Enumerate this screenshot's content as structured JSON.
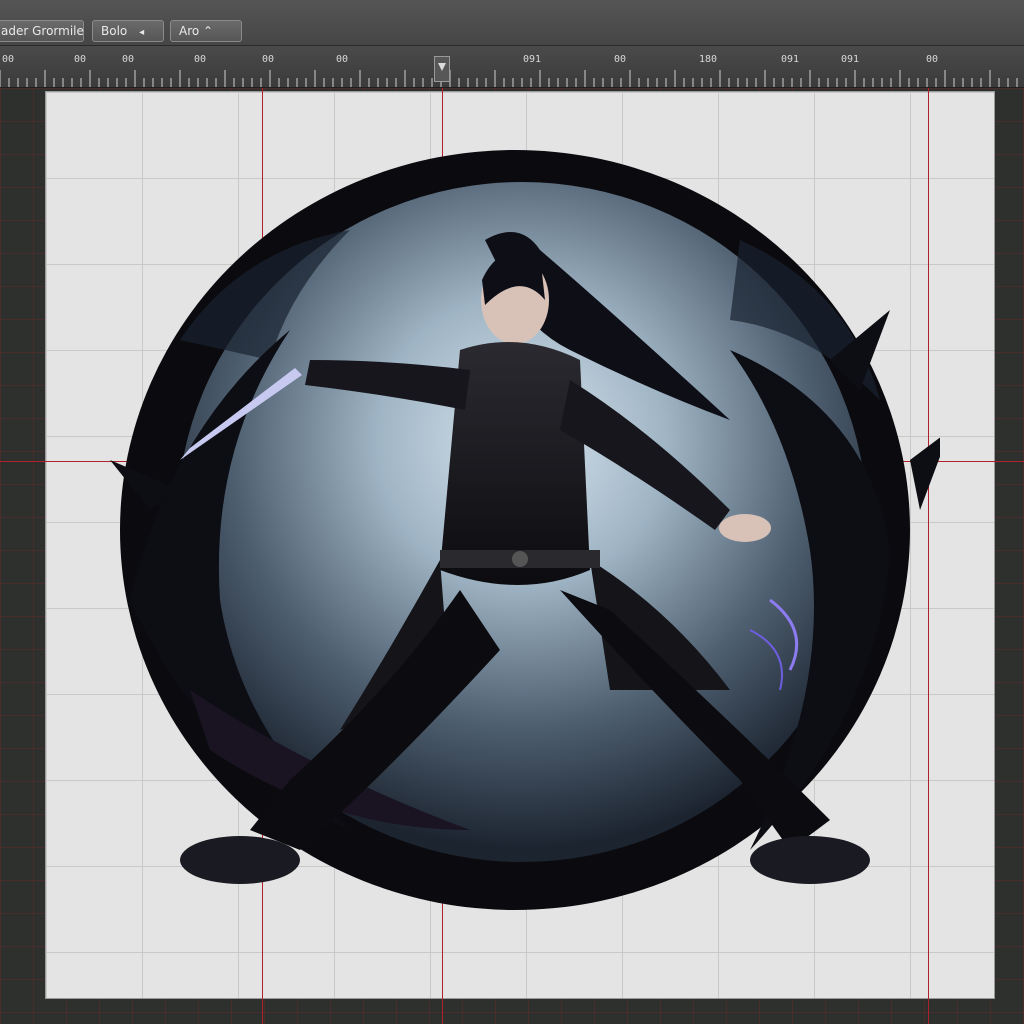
{
  "toolbar": {
    "title_partial": "ader Grormile",
    "button_1_label": "Bolo",
    "button_1_caret": "◂",
    "button_2_label": "Aro ⌃"
  },
  "ruler": {
    "labels": [
      "00",
      "00",
      "00",
      "00",
      "00",
      "00",
      "091",
      "00",
      "180",
      "091",
      "091",
      "00"
    ]
  },
  "colors": {
    "canvas_bg": "#e4e4e4",
    "guide": "#b0202a",
    "workspace_bg": "#2e302e",
    "orb_glow": "#cfe0ee",
    "magic_accent": "#8c7cf0"
  },
  "icons": {
    "ruler_marker": "playhead-marker-icon",
    "dropdown": "caret-left-icon"
  }
}
